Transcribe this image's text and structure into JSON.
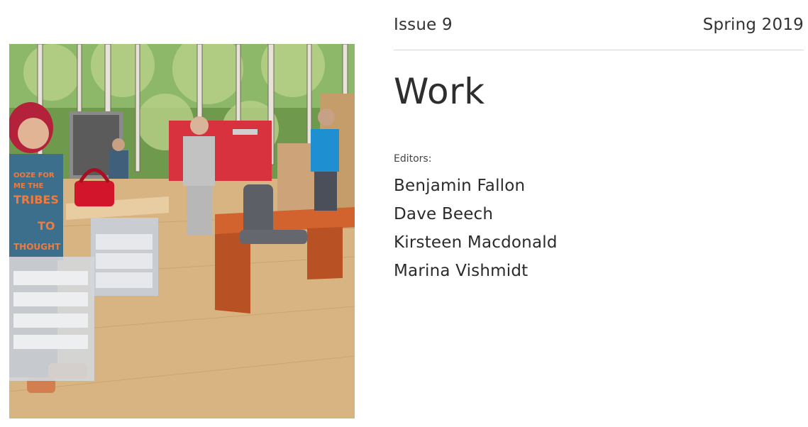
{
  "cover": {
    "alt_icon": "illustration-icon",
    "shirt_text": [
      "OOZE FOR",
      "ME THE",
      "TRIBES",
      "TO",
      "THOUGHT"
    ]
  },
  "issue": {
    "number": "Issue 9",
    "season": "Spring 2019",
    "title": "Work",
    "editors_label": "Editors:",
    "editors": [
      "Benjamin Fallon",
      "Dave Beech",
      "Kirsteen Macdonald",
      "Marina Vishmidt"
    ]
  }
}
